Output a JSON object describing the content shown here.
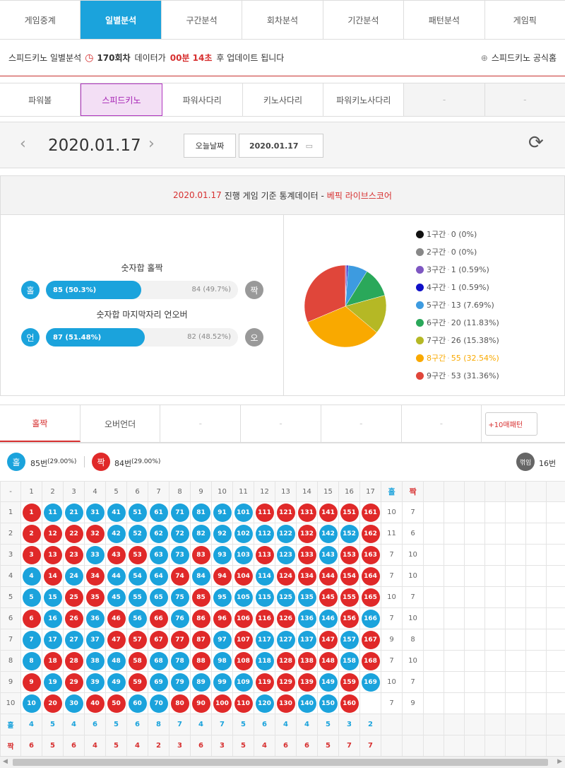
{
  "main_tabs": [
    "게임중계",
    "일별분석",
    "구간분석",
    "회차분석",
    "기간분석",
    "패턴분석",
    "게임픽"
  ],
  "info": {
    "text1": "스피드키노 일별분석",
    "round": "170회차",
    "text2": "데이터가",
    "time": "00분 14초",
    "text3": "후 업데이트 됩니다",
    "home": "스피드키노 공식홈"
  },
  "game_tabs": [
    "파워볼",
    "스피드키노",
    "파워사다리",
    "키노사다리",
    "파워키노사다리",
    "-",
    "-"
  ],
  "datebar": {
    "date": "2020.01.17",
    "today": "오늘날짜",
    "picker": "2020.01.17"
  },
  "stat": {
    "date": "2020.01.17",
    "text": "진행 게임 기준 통계데이터 -",
    "brand": "베픽 라이브스코어",
    "oe_title": "숫자합 홀짝",
    "odd_label": "홀",
    "odd": "85 (50.3%)",
    "odd_pct": 50.3,
    "even": "84 (49.7%)",
    "even_label": "짝",
    "uo_title": "숫자합 마지막자리 언오버",
    "under_label": "언",
    "under": "87 (51.48%)",
    "under_pct": 51.48,
    "over": "82 (48.52%)",
    "over_label": "오"
  },
  "chart_data": {
    "type": "pie",
    "categories": [
      "1구간",
      "2구간",
      "3구간",
      "4구간",
      "5구간",
      "6구간",
      "7구간",
      "8구간",
      "9구간"
    ],
    "values": [
      0,
      0,
      1,
      1,
      13,
      20,
      26,
      55,
      53
    ],
    "labels": [
      "0 (0%)",
      "0 (0%)",
      "1 (0.59%)",
      "1 (0.59%)",
      "13 (7.69%)",
      "20 (11.83%)",
      "26 (15.38%)",
      "55 (32.54%)",
      "53 (31.36%)"
    ],
    "colors": [
      "#111111",
      "#888888",
      "#7e57c2",
      "#1010c8",
      "#3d9be0",
      "#2aa85a",
      "#b5b825",
      "#f9a900",
      "#e0463a"
    ]
  },
  "pattern_tabs": [
    "홀짝",
    "오버언더",
    "-",
    "-",
    "-",
    "-",
    "+10매패턴"
  ],
  "summary": {
    "odd_label": "홀",
    "odd": "85번",
    "odd_pct": "(29.00%)",
    "even_label": "짝",
    "even": "84번",
    "even_pct": "(29.00%)",
    "flip_label": "꺾임",
    "flip": "16번"
  },
  "grid": {
    "header": [
      "-",
      "1",
      "2",
      "3",
      "4",
      "5",
      "6",
      "7",
      "8",
      "9",
      "10",
      "11",
      "12",
      "13",
      "14",
      "15",
      "16",
      "17",
      "홀",
      "짝"
    ],
    "rows": [
      {
        "n": "1",
        "balls": [
          [
            "1",
            "r"
          ],
          [
            "11",
            "b"
          ],
          [
            "21",
            "b"
          ],
          [
            "31",
            "b"
          ],
          [
            "41",
            "b"
          ],
          [
            "51",
            "b"
          ],
          [
            "61",
            "b"
          ],
          [
            "71",
            "b"
          ],
          [
            "81",
            "b"
          ],
          [
            "91",
            "b"
          ],
          [
            "101",
            "b"
          ],
          [
            "111",
            "r"
          ],
          [
            "121",
            "r"
          ],
          [
            "131",
            "r"
          ],
          [
            "141",
            "r"
          ],
          [
            "151",
            "r"
          ],
          [
            "161",
            "r"
          ]
        ],
        "odd": "10",
        "even": "7"
      },
      {
        "n": "2",
        "balls": [
          [
            "2",
            "r"
          ],
          [
            "12",
            "r"
          ],
          [
            "22",
            "r"
          ],
          [
            "32",
            "r"
          ],
          [
            "42",
            "b"
          ],
          [
            "52",
            "b"
          ],
          [
            "62",
            "b"
          ],
          [
            "72",
            "b"
          ],
          [
            "82",
            "b"
          ],
          [
            "92",
            "b"
          ],
          [
            "102",
            "b"
          ],
          [
            "112",
            "b"
          ],
          [
            "122",
            "b"
          ],
          [
            "132",
            "r"
          ],
          [
            "142",
            "b"
          ],
          [
            "152",
            "b"
          ],
          [
            "162",
            "r"
          ]
        ],
        "odd": "11",
        "even": "6"
      },
      {
        "n": "3",
        "balls": [
          [
            "3",
            "r"
          ],
          [
            "13",
            "r"
          ],
          [
            "23",
            "r"
          ],
          [
            "33",
            "b"
          ],
          [
            "43",
            "r"
          ],
          [
            "53",
            "r"
          ],
          [
            "63",
            "b"
          ],
          [
            "73",
            "b"
          ],
          [
            "83",
            "r"
          ],
          [
            "93",
            "b"
          ],
          [
            "103",
            "b"
          ],
          [
            "113",
            "r"
          ],
          [
            "123",
            "b"
          ],
          [
            "133",
            "r"
          ],
          [
            "143",
            "b"
          ],
          [
            "153",
            "r"
          ],
          [
            "163",
            "r"
          ]
        ],
        "odd": "7",
        "even": "10"
      },
      {
        "n": "4",
        "balls": [
          [
            "4",
            "b"
          ],
          [
            "14",
            "r"
          ],
          [
            "24",
            "b"
          ],
          [
            "34",
            "r"
          ],
          [
            "44",
            "b"
          ],
          [
            "54",
            "b"
          ],
          [
            "64",
            "b"
          ],
          [
            "74",
            "r"
          ],
          [
            "84",
            "b"
          ],
          [
            "94",
            "r"
          ],
          [
            "104",
            "r"
          ],
          [
            "114",
            "b"
          ],
          [
            "124",
            "r"
          ],
          [
            "134",
            "r"
          ],
          [
            "144",
            "r"
          ],
          [
            "154",
            "r"
          ],
          [
            "164",
            "r"
          ]
        ],
        "odd": "7",
        "even": "10"
      },
      {
        "n": "5",
        "balls": [
          [
            "5",
            "b"
          ],
          [
            "15",
            "b"
          ],
          [
            "25",
            "r"
          ],
          [
            "35",
            "r"
          ],
          [
            "45",
            "b"
          ],
          [
            "55",
            "b"
          ],
          [
            "65",
            "b"
          ],
          [
            "75",
            "b"
          ],
          [
            "85",
            "r"
          ],
          [
            "95",
            "b"
          ],
          [
            "105",
            "b"
          ],
          [
            "115",
            "b"
          ],
          [
            "125",
            "b"
          ],
          [
            "135",
            "b"
          ],
          [
            "145",
            "r"
          ],
          [
            "155",
            "r"
          ],
          [
            "165",
            "r"
          ]
        ],
        "odd": "10",
        "even": "7"
      },
      {
        "n": "6",
        "balls": [
          [
            "6",
            "r"
          ],
          [
            "16",
            "b"
          ],
          [
            "26",
            "r"
          ],
          [
            "36",
            "b"
          ],
          [
            "46",
            "r"
          ],
          [
            "56",
            "b"
          ],
          [
            "66",
            "r"
          ],
          [
            "76",
            "b"
          ],
          [
            "86",
            "r"
          ],
          [
            "96",
            "r"
          ],
          [
            "106",
            "r"
          ],
          [
            "116",
            "r"
          ],
          [
            "126",
            "r"
          ],
          [
            "136",
            "b"
          ],
          [
            "146",
            "b"
          ],
          [
            "156",
            "r"
          ],
          [
            "166",
            "b"
          ]
        ],
        "odd": "7",
        "even": "10"
      },
      {
        "n": "7",
        "balls": [
          [
            "7",
            "b"
          ],
          [
            "17",
            "b"
          ],
          [
            "27",
            "b"
          ],
          [
            "37",
            "b"
          ],
          [
            "47",
            "r"
          ],
          [
            "57",
            "r"
          ],
          [
            "67",
            "r"
          ],
          [
            "77",
            "r"
          ],
          [
            "87",
            "r"
          ],
          [
            "97",
            "b"
          ],
          [
            "107",
            "r"
          ],
          [
            "117",
            "b"
          ],
          [
            "127",
            "b"
          ],
          [
            "137",
            "b"
          ],
          [
            "147",
            "r"
          ],
          [
            "157",
            "b"
          ],
          [
            "167",
            "r"
          ]
        ],
        "odd": "9",
        "even": "8"
      },
      {
        "n": "8",
        "balls": [
          [
            "8",
            "b"
          ],
          [
            "18",
            "r"
          ],
          [
            "28",
            "r"
          ],
          [
            "38",
            "b"
          ],
          [
            "48",
            "b"
          ],
          [
            "58",
            "r"
          ],
          [
            "68",
            "b"
          ],
          [
            "78",
            "b"
          ],
          [
            "88",
            "r"
          ],
          [
            "98",
            "b"
          ],
          [
            "108",
            "r"
          ],
          [
            "118",
            "b"
          ],
          [
            "128",
            "r"
          ],
          [
            "138",
            "r"
          ],
          [
            "148",
            "r"
          ],
          [
            "158",
            "b"
          ],
          [
            "168",
            "r"
          ]
        ],
        "odd": "7",
        "even": "10"
      },
      {
        "n": "9",
        "balls": [
          [
            "9",
            "r"
          ],
          [
            "19",
            "b"
          ],
          [
            "29",
            "r"
          ],
          [
            "39",
            "b"
          ],
          [
            "49",
            "b"
          ],
          [
            "59",
            "r"
          ],
          [
            "69",
            "b"
          ],
          [
            "79",
            "b"
          ],
          [
            "89",
            "b"
          ],
          [
            "99",
            "b"
          ],
          [
            "109",
            "b"
          ],
          [
            "119",
            "r"
          ],
          [
            "129",
            "r"
          ],
          [
            "139",
            "r"
          ],
          [
            "149",
            "b"
          ],
          [
            "159",
            "r"
          ],
          [
            "169",
            "b"
          ]
        ],
        "odd": "10",
        "even": "7"
      },
      {
        "n": "10",
        "balls": [
          [
            "10",
            "b"
          ],
          [
            "20",
            "r"
          ],
          [
            "30",
            "b"
          ],
          [
            "40",
            "r"
          ],
          [
            "50",
            "r"
          ],
          [
            "60",
            "b"
          ],
          [
            "70",
            "b"
          ],
          [
            "80",
            "r"
          ],
          [
            "90",
            "r"
          ],
          [
            "100",
            "r"
          ],
          [
            "110",
            "r"
          ],
          [
            "120",
            "b"
          ],
          [
            "130",
            "r"
          ],
          [
            "140",
            "b"
          ],
          [
            "150",
            "b"
          ],
          [
            "160",
            "r"
          ]
        ],
        "odd": "7",
        "even": "9"
      }
    ],
    "odd_row": {
      "label": "홀",
      "vals": [
        "4",
        "5",
        "4",
        "6",
        "5",
        "6",
        "8",
        "7",
        "4",
        "7",
        "5",
        "6",
        "4",
        "4",
        "5",
        "3",
        "2"
      ]
    },
    "even_row": {
      "label": "짝",
      "vals": [
        "6",
        "5",
        "6",
        "4",
        "5",
        "4",
        "2",
        "3",
        "6",
        "3",
        "5",
        "4",
        "6",
        "6",
        "5",
        "7",
        "7"
      ]
    }
  }
}
